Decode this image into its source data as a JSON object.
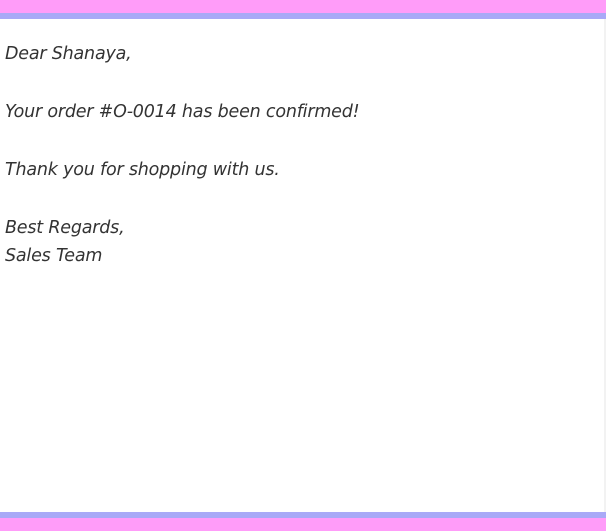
{
  "email": {
    "greeting": "Dear Shanaya,",
    "confirmation": "Your order #O-0014 has been confirmed!",
    "thanks": "Thank you for shopping with us.",
    "closing": "Best Regards,",
    "signature": "Sales Team"
  },
  "colors": {
    "band_pink": "#ff9cf9",
    "band_lavender": "#a9a9f7",
    "text": "#333333"
  }
}
